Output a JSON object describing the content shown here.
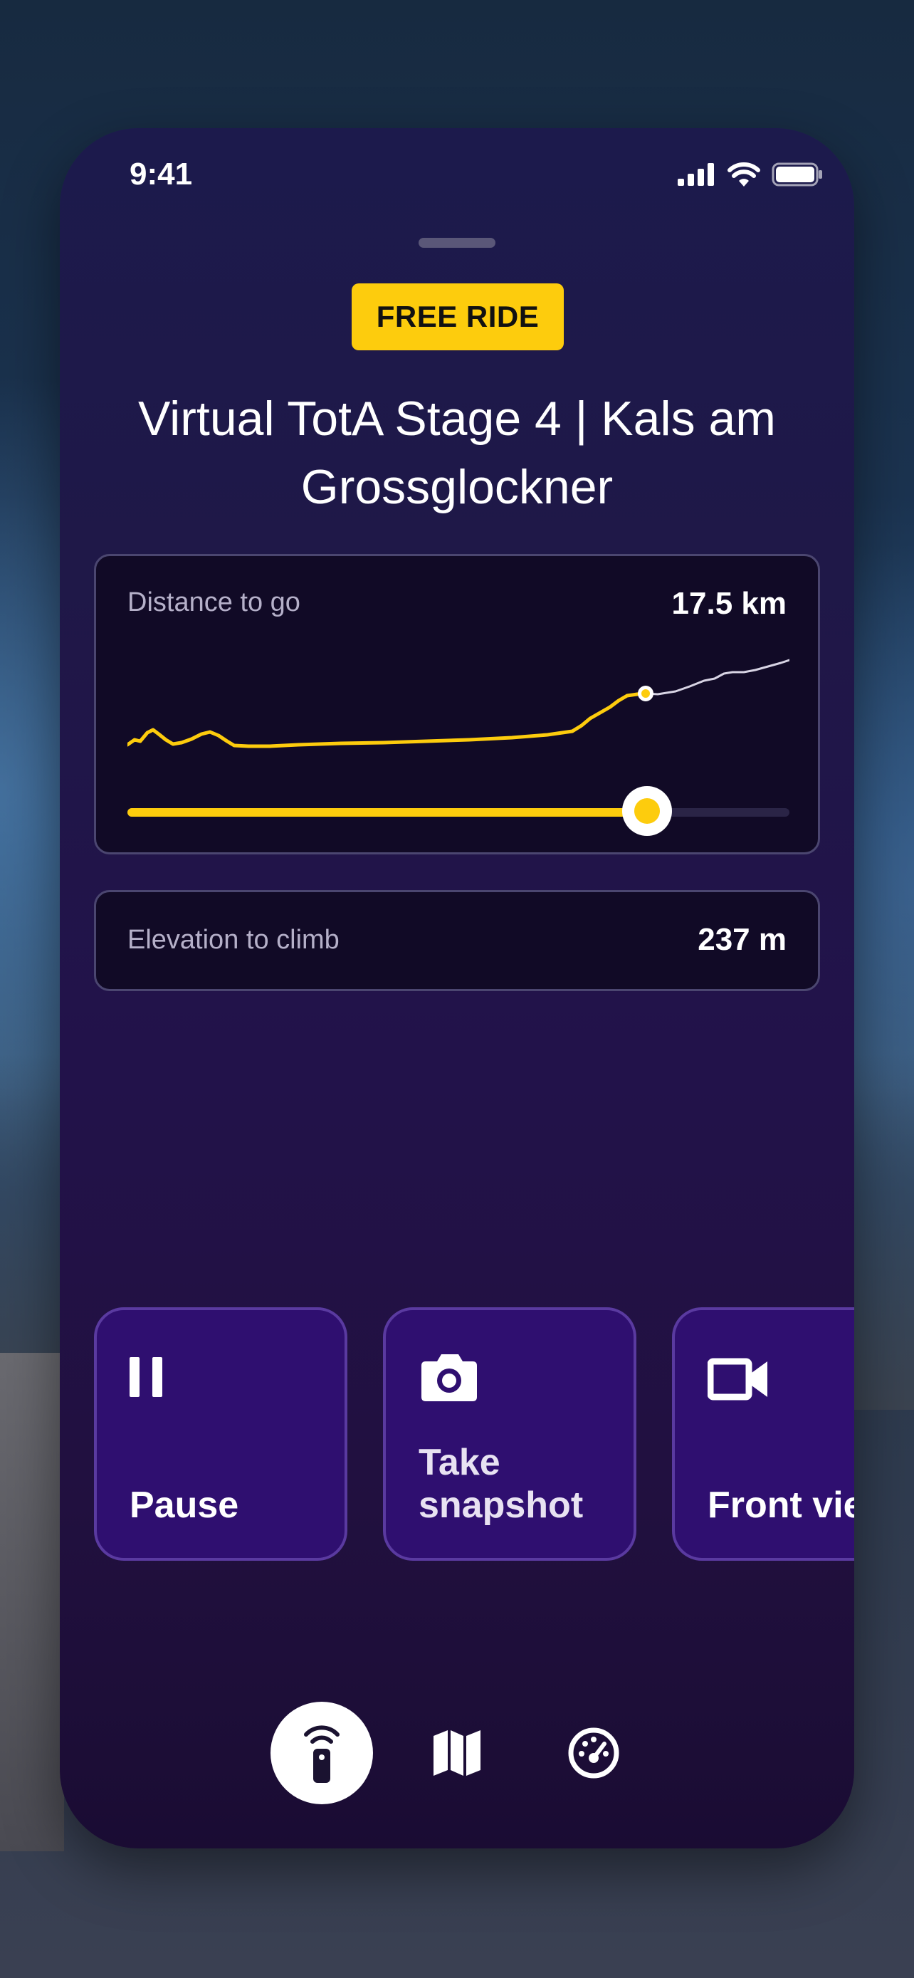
{
  "status_bar": {
    "time": "9:41"
  },
  "mode_badge": "FREE RIDE",
  "ride_title": "Virtual TotA Stage 4 | Kals am Grossglockner",
  "distance": {
    "label": "Distance to go",
    "value": "17.5 km",
    "progress": 0.785
  },
  "elevation": {
    "label": "Elevation to climb",
    "value": "237 m"
  },
  "actions": [
    {
      "label": "Pause",
      "icon": "pause-icon"
    },
    {
      "label": "Take snapshot",
      "icon": "camera-icon"
    },
    {
      "label": "Front vie",
      "icon": "video-camera-icon"
    }
  ],
  "nav": [
    {
      "name": "remote",
      "icon": "remote-control-icon",
      "active": true
    },
    {
      "name": "map",
      "icon": "map-icon",
      "active": false
    },
    {
      "name": "dashboard",
      "icon": "speedometer-icon",
      "active": false
    }
  ],
  "colors": {
    "accent": "#fdcc0d",
    "card_bg": "#110a26",
    "action_bg": "#2f0f70",
    "profile_remaining": "#d8d4e4"
  }
}
